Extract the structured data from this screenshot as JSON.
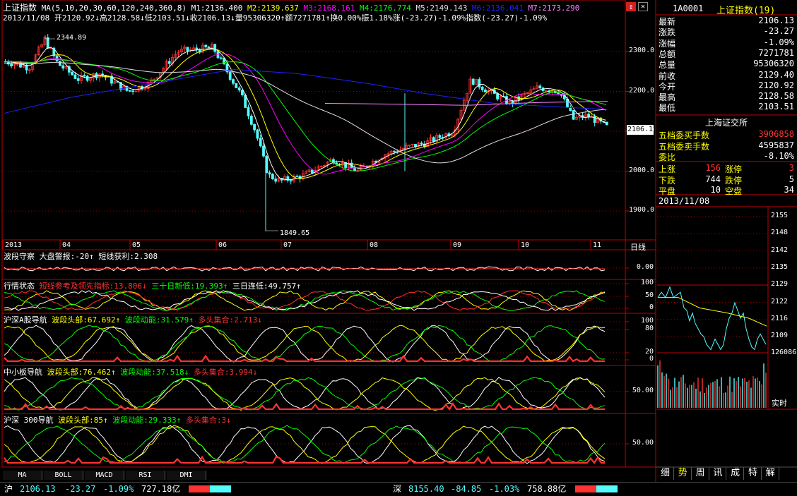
{
  "colors": {
    "up": "#ff3232",
    "down": "#54fcfc",
    "grid": "#a00000",
    "axis": "#c00000",
    "ma1": "#ffffff",
    "ma2": "#ffff00",
    "ma3": "#ff00ff",
    "ma4": "#00ff00",
    "ma5": "#e0e0e0",
    "ma6": "#2020ff",
    "ma7": "#ff80ff"
  },
  "header": {
    "title": "上证指数",
    "ma_label": "MA(5,10,20,30,60,120,240,360,8)",
    "ma_values": [
      {
        "text": "M1:2136.400",
        "color": "#ffffff"
      },
      {
        "text": "M2:2139.637",
        "color": "#ffff00"
      },
      {
        "text": "M3:2168.161",
        "color": "#ff00ff"
      },
      {
        "text": "M4:2176.774",
        "color": "#00ff00"
      },
      {
        "text": "M5:2149.143",
        "color": "#e0e0e0"
      },
      {
        "text": "M6:2136.041",
        "color": "#2020ff"
      },
      {
        "text": "M7:2173.290",
        "color": "#ff80ff"
      }
    ],
    "ohlc_line": "2013/11/08 开2120.92↓高2128.58↓低2103.51↓收2106.13↓量95306320↑额7271781↑换0.00%振1.18%涨(-23.27)-1.09%指数(-23.27)-1.09%"
  },
  "price_chart": {
    "y_ticks": [
      "2300.0",
      "2200.0",
      "2100.0",
      "2000.0",
      "1900.0"
    ],
    "y_tick_values": [
      2300,
      2200,
      2100,
      2000,
      1900
    ],
    "current_price": "2106.1",
    "high_label": "2344.89",
    "low_label": "1849.65",
    "x_ticks": [
      "2013",
      "04",
      "05",
      "06",
      "07",
      "08",
      "09",
      "10",
      "11"
    ],
    "period": "日线"
  },
  "indicators": [
    {
      "name": "波段守察",
      "items": [
        {
          "text": "大盘警报:-20↑",
          "color": "#fff"
        },
        {
          "text": "短线获利:2.308",
          "color": "#fff"
        }
      ],
      "ticks": [
        "0.00"
      ]
    },
    {
      "name": "行情状态",
      "items": [
        {
          "text": "短线参考及领先指标:13.806↓",
          "color": "#ff3232"
        },
        {
          "text": "三十日新低:19.393↑",
          "color": "#00ff00"
        },
        {
          "text": "三日连低:49.757↑",
          "color": "#fff"
        }
      ],
      "ticks": [
        "100",
        "50",
        "0"
      ]
    },
    {
      "name": "沪深A股导航",
      "items": [
        {
          "text": "波段头部:67.692↑",
          "color": "#ffff00"
        },
        {
          "text": "波段动能:31.579↑",
          "color": "#00ff00"
        },
        {
          "text": "多头集合:2.713↓",
          "color": "#ff3232"
        }
      ],
      "ticks": [
        "100",
        "80",
        "20",
        "0"
      ]
    },
    {
      "name": "中小板导航",
      "items": [
        {
          "text": "波段头部:76.462↑",
          "color": "#ffff00"
        },
        {
          "text": "波段动能:37.518↓",
          "color": "#00ff00"
        },
        {
          "text": "多头集合:3.994↓",
          "color": "#ff3232"
        }
      ],
      "ticks": [
        "50.00"
      ]
    },
    {
      "name": "沪深 300导航",
      "items": [
        {
          "text": "波段头部:85↑",
          "color": "#ffff00"
        },
        {
          "text": "波段动能:29.333↑",
          "color": "#00ff00"
        },
        {
          "text": "多头集合:3↓",
          "color": "#ff3232"
        }
      ],
      "ticks": [
        "50.00"
      ]
    }
  ],
  "bottom_tabs": [
    "MA",
    "BOLL",
    "MACD",
    "RSI",
    "DMI"
  ],
  "quote": {
    "code": "1A0001",
    "name": "上证指数(19)",
    "rows": [
      {
        "label": "最新",
        "value": "2106.13",
        "color": "#ffffff"
      },
      {
        "label": "涨跌",
        "value": "-23.27",
        "color": "#ffffff"
      },
      {
        "label": "涨幅",
        "value": "-1.09%",
        "color": "#ffffff"
      },
      {
        "label": "总额",
        "value": "7271781",
        "color": "#ffffff"
      },
      {
        "label": "总量",
        "value": "95306320",
        "color": "#ffffff"
      },
      {
        "label": "前收",
        "value": "2129.40",
        "color": "#ffffff"
      },
      {
        "label": "今开",
        "value": "2120.92",
        "color": "#ffffff"
      },
      {
        "label": "最高",
        "value": "2128.58",
        "color": "#ffffff"
      },
      {
        "label": "最低",
        "value": "2103.51",
        "color": "#ffffff"
      }
    ],
    "exchange": "上海证交所",
    "depth": [
      {
        "label": "五档委买手数",
        "value": "3906858",
        "color": "#ff3232"
      },
      {
        "label": "五档委卖手数",
        "value": "4595837",
        "color": "#ffffff"
      },
      {
        "label": "委比",
        "value": "-8.10%",
        "color": "#ffffff"
      }
    ],
    "breadth": [
      {
        "l1": "上涨",
        "v1": "156",
        "c1": "#ff3232",
        "l2": "涨停",
        "v2": "3",
        "c2": "#ff3232"
      },
      {
        "l1": "下跌",
        "v1": "744",
        "c1": "#ffffff",
        "l2": "跌停",
        "v2": "5",
        "c2": "#ffffff"
      },
      {
        "l1": "平盘",
        "v1": "10",
        "c1": "#ffffff",
        "l2": "空盘",
        "v2": "34",
        "c2": "#ffffff"
      }
    ],
    "date": "2013/11/08"
  },
  "intraday": {
    "y_ticks": [
      "2155",
      "2148",
      "2142",
      "2135",
      "2129",
      "2122",
      "2116",
      "2109"
    ],
    "volume_tick": "126086",
    "label": "实时"
  },
  "right_tabs": [
    "细",
    "势",
    "周",
    "讯",
    "成",
    "特",
    "解"
  ],
  "status_bar": {
    "sh": {
      "name": "沪",
      "price": "2106.13",
      "change": "-23.27",
      "pct": "-1.09%",
      "amount": "727.18亿"
    },
    "sz": {
      "name": "深",
      "price": "8155.40",
      "change": "-84.85",
      "pct": "-1.03%",
      "amount": "758.88亿"
    }
  }
}
